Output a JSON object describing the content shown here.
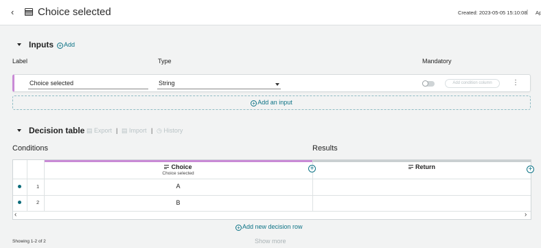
{
  "header": {
    "title": "Choice selected",
    "created": "Created: 2023-05-05 15:10:08",
    "separator": "|",
    "truncated": "Ap"
  },
  "inputs": {
    "title": "Inputs",
    "add_label": "Add",
    "columns": {
      "label": "Label",
      "type": "Type",
      "mandatory": "Mandatory"
    },
    "row": {
      "label_value": "Choice selected",
      "type_value": "String",
      "mandatory": false,
      "add_condition_column": "Add condition column"
    },
    "add_input_label": "Add an input"
  },
  "decision_table": {
    "title": "Decision table",
    "actions": {
      "export": "Export",
      "import": "Import",
      "history": "History"
    },
    "separator": "|",
    "conditions_label": "Conditions",
    "results_label": "Results",
    "condition_column": {
      "name": "Choice",
      "subtitle": "Choice selected"
    },
    "result_column": {
      "name": "Return"
    },
    "rows": [
      {
        "index": "1",
        "choice": "A",
        "return": ""
      },
      {
        "index": "2",
        "choice": "B",
        "return": ""
      }
    ],
    "add_row_label": "Add new decision row",
    "showing": "Showing 1-2 of 2",
    "show_more": "Show more"
  },
  "colors": {
    "accent": "#0b7285",
    "condition_accent": "#c98ad6",
    "row_dot": "#0b6b7a"
  }
}
